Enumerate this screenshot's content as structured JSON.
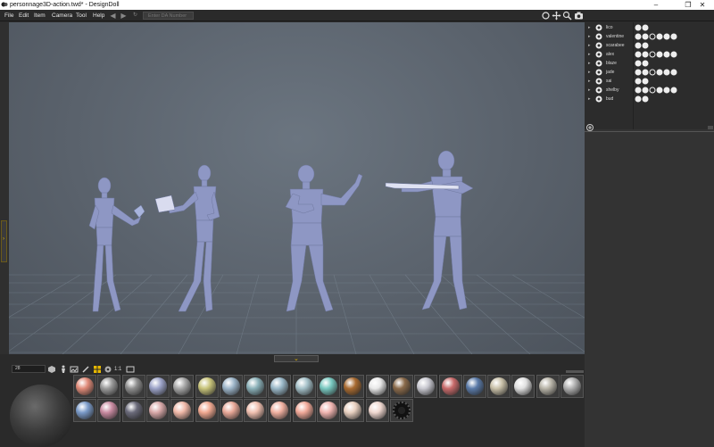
{
  "window": {
    "title": "personnage3D-action.twd* - DesignDoll",
    "minimize": "–",
    "restore": "❐",
    "close": "✕"
  },
  "menu": [
    "File",
    "Edit",
    "Item",
    "Camera",
    "Tool",
    "Help"
  ],
  "da_number": {
    "placeholder": "Enter DA Number"
  },
  "toolbar_icons": [
    "rotate-view-icon",
    "pan-view-icon",
    "zoom-view-icon",
    "camera-snapshot-icon"
  ],
  "dolls": [
    {
      "name": "lico"
    },
    {
      "name": "valentine"
    },
    {
      "name": "scarabee"
    },
    {
      "name": "alex"
    },
    {
      "name": "blaze"
    },
    {
      "name": "jade"
    },
    {
      "name": "sai"
    },
    {
      "name": "shelby"
    },
    {
      "name": "bud"
    }
  ],
  "material_size": "28",
  "material_scale_label": "1:1",
  "colors": {
    "accent": "#e6b800",
    "viewport_bg": "#5e6670",
    "panel_bg": "#2a2a2a"
  },
  "materials_row1": [
    "#e08a78",
    "#9a9a9a",
    "#8e8e8e",
    "#9ca3c8",
    "#a8a8a8",
    "#c8c47a",
    "#9cb4c8",
    "#8ab0b8",
    "#9ab8c8",
    "#a4c0c8",
    "#78c8c0",
    "#a86a30",
    "#e8e8e8",
    "#8a6a4a",
    "#c8c8d0",
    "#c86a6a",
    "#5a7aa8",
    "#c8c0a8",
    "#e0e0e0",
    "#b8b4a8",
    "#b0b0b0"
  ],
  "materials_row2": [
    "#7a9ac8",
    "#c88aa0",
    "#6a6a7a",
    "#d8a8a8",
    "#f0b8a8",
    "#f0a890",
    "#e8a898",
    "#f0c0b0",
    "#f0b0a0",
    "#f0a898",
    "#f0b4b0",
    "#e8d0c0",
    "#f0d8d0",
    "gear"
  ]
}
